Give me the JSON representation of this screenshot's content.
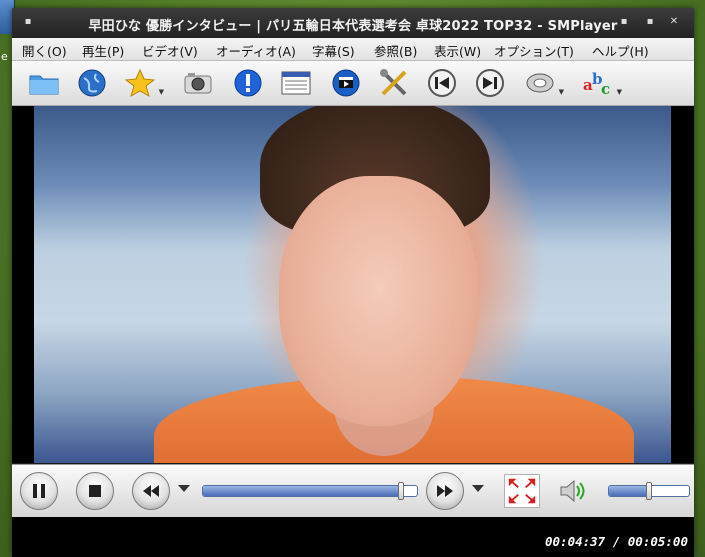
{
  "window": {
    "title": "早田ひな 優勝インタビュー | パリ五輪日本代表選考会 卓球2022 TOP32 - SMPlayer"
  },
  "menubar": {
    "items": [
      {
        "label": "開く(O)"
      },
      {
        "label": "再生(P)"
      },
      {
        "label": "ビデオ(V)"
      },
      {
        "label": "オーディオ(A)"
      },
      {
        "label": "字幕(S)"
      },
      {
        "label": "参照(B)"
      },
      {
        "label": "表示(W)"
      },
      {
        "label": "オプション(T)"
      },
      {
        "label": "ヘルプ(H)"
      }
    ]
  },
  "toolbar": {
    "icons": [
      "folder-icon",
      "globe-icon",
      "star-icon",
      "camera-icon",
      "info-icon",
      "playlist-icon",
      "clapperboard-icon",
      "tools-icon",
      "previous-icon",
      "next-icon",
      "audio-disc-icon",
      "subtitle-abc-icon"
    ]
  },
  "desktop": {
    "letter": "e"
  },
  "playback": {
    "position_fraction": 0.925,
    "volume_fraction": 0.5,
    "time_display": "00:04:37 / 00:05:00"
  },
  "colors": {
    "accent": "#4b6fb8",
    "titlebar": "#2a2a2a"
  }
}
